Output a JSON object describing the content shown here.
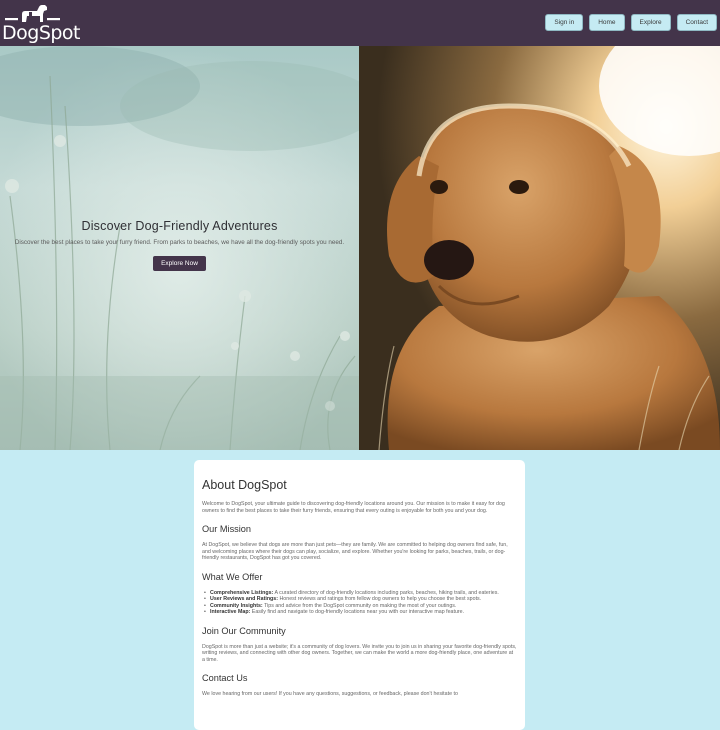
{
  "header": {
    "logo_text": "DogSpot",
    "logo_icon": "dog-icon",
    "nav": [
      "Sign in",
      "Home",
      "Explore",
      "Contact"
    ]
  },
  "hero": {
    "title": "Discover Dog-Friendly Adventures",
    "subtitle": "Discover the best places to take your furry friend. From parks to beaches, we have all the dog-friendly spots you need.",
    "button": "Explore Now"
  },
  "about": {
    "title": "About DogSpot",
    "intro": "Welcome to DogSpot, your ultimate guide to discovering dog-friendly locations around you. Our mission is to make it easy for dog owners to find the best places to take their furry friends, ensuring that every outing is enjoyable for both you and your dog.",
    "mission_title": "Our Mission",
    "mission_text": "At DogSpot, we believe that dogs are more than just pets—they are family. We are committed to helping dog owners find safe, fun, and welcoming places where their dogs can play, socialize, and explore. Whether you're looking for parks, beaches, trails, or dog-friendly restaurants, DogSpot has got you covered.",
    "offer_title": "What We Offer",
    "offers": [
      {
        "label": "Comprehensive Listings:",
        "text": " A curated directory of dog-friendly locations including parks, beaches, hiking trails, and eateries."
      },
      {
        "label": "User Reviews and Ratings:",
        "text": " Honest reviews and ratings from fellow dog owners to help you choose the best spots."
      },
      {
        "label": "Community Insights:",
        "text": " Tips and advice from the DogSpot community on making the most of your outings."
      },
      {
        "label": "Interactive Map:",
        "text": " Easily find and navigate to dog-friendly locations near you with our interactive map feature."
      }
    ],
    "community_title": "Join Our Community",
    "community_text": "DogSpot is more than just a website; it's a community of dog lovers. We invite you to join us in sharing your favorite dog-friendly spots, writing reviews, and connecting with other dog owners. Together, we can make the world a more dog-friendly place, one adventure at a time.",
    "contact_title": "Contact Us",
    "contact_text": "We love hearing from our users! If you have any questions, suggestions, or feedback, please don't hesitate to"
  },
  "colors": {
    "header_bg": "#43344a",
    "page_bg": "#c5ebf3",
    "nav_button_bg": "#c5ebf3",
    "cta_bg": "#43344a"
  }
}
